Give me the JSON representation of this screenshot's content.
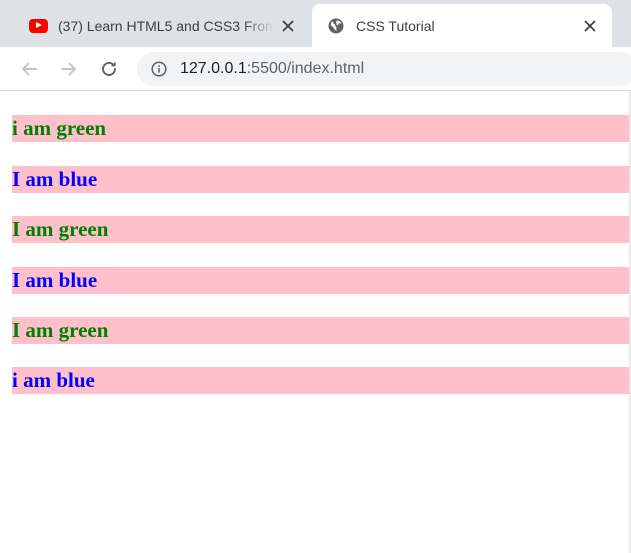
{
  "browser": {
    "tabs": [
      {
        "title": "(37) Learn HTML5 and CSS3 From Scratch",
        "favicon": "youtube-icon",
        "active": false
      },
      {
        "title": "CSS Tutorial",
        "favicon": "globe-icon",
        "active": true
      }
    ],
    "toolbar": {
      "back_icon": "back-arrow-icon",
      "forward_icon": "forward-arrow-icon",
      "reload_icon": "reload-icon",
      "site_info_icon": "info-icon",
      "url_host": "127.0.0.1",
      "url_path": ":5500/index.html"
    }
  },
  "page": {
    "background": "#ffffff",
    "lines": [
      {
        "text": "i am green",
        "color": "#008000",
        "background": "#ffc0cb"
      },
      {
        "text": "I am blue",
        "color": "#0000ff",
        "background": "#ffc0cb"
      },
      {
        "text": "I am green",
        "color": "#008000",
        "background": "#ffc0cb"
      },
      {
        "text": "I am blue",
        "color": "#0000ff",
        "background": "#ffc0cb"
      },
      {
        "text": "I am green",
        "color": "#008000",
        "background": "#ffc0cb"
      },
      {
        "text": "i am blue",
        "color": "#0000ff",
        "background": "#ffc0cb"
      }
    ]
  }
}
